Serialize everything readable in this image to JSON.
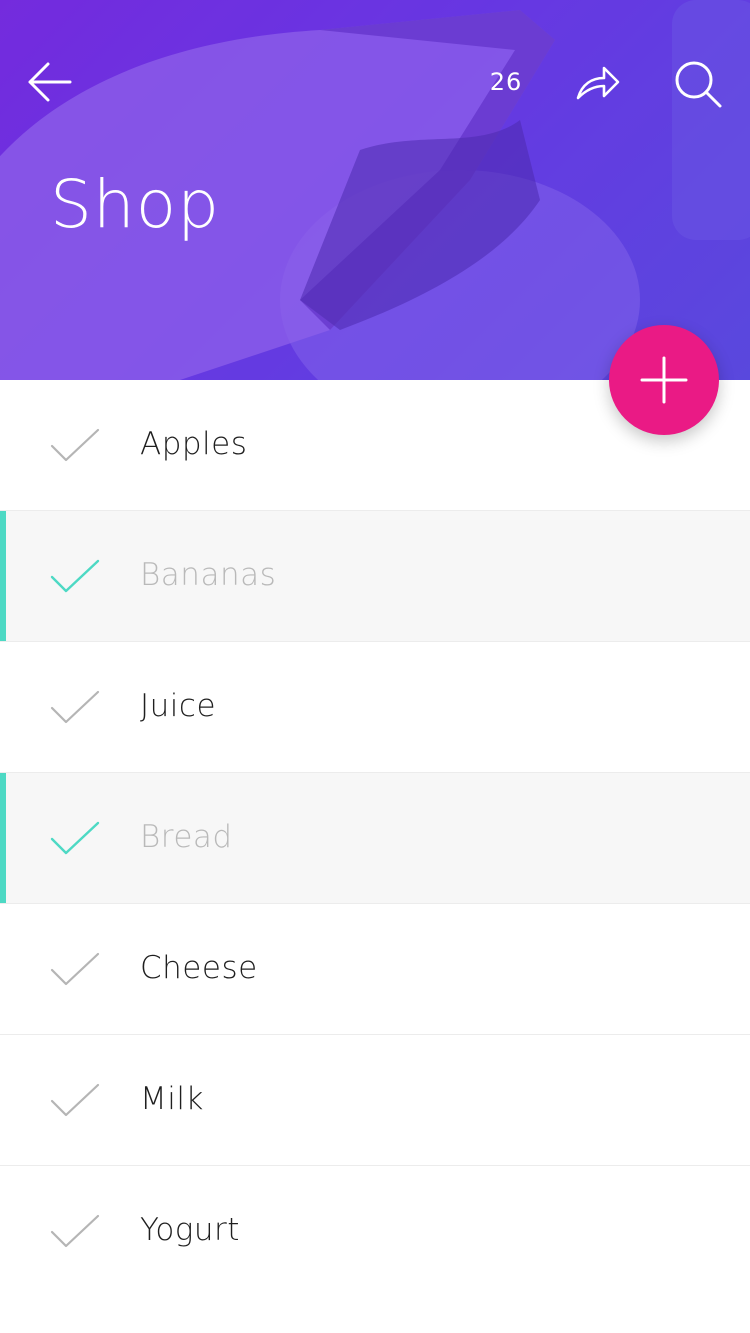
{
  "header": {
    "title": "Shop",
    "item_count": "26",
    "gradient_start": "#7a2be0",
    "gradient_end": "#5a4fe0",
    "icons": {
      "back": "arrow-left-icon",
      "share": "share-icon",
      "search": "search-icon"
    }
  },
  "fab": {
    "icon": "plus-icon",
    "color": "#ea1a85"
  },
  "list": {
    "items": [
      {
        "label": "Apples",
        "checked": false
      },
      {
        "label": "Bananas",
        "checked": true
      },
      {
        "label": "Juice",
        "checked": false
      },
      {
        "label": "Bread",
        "checked": true
      },
      {
        "label": "Cheese",
        "checked": false
      },
      {
        "label": "Milk",
        "checked": false
      },
      {
        "label": "Yogurt",
        "checked": false
      }
    ],
    "checked_accent": "#4dd9c4",
    "unchecked_check_color": "#b5b5b5"
  }
}
